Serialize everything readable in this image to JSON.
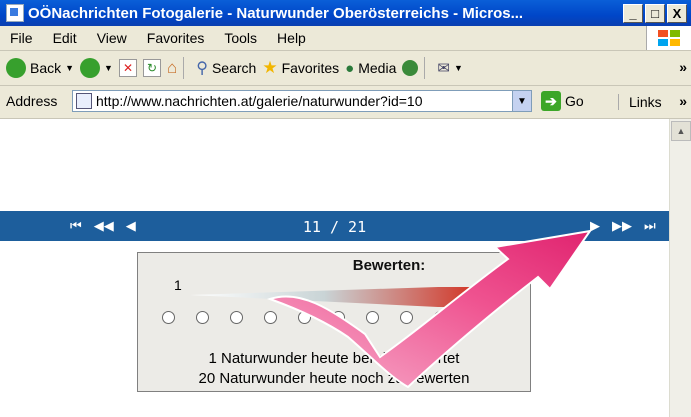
{
  "window": {
    "title": "OÖNachrichten Fotogalerie - Naturwunder Oberösterreichs - Micros...",
    "buttons": [
      "_",
      "□",
      "X"
    ]
  },
  "menu": [
    "File",
    "Edit",
    "View",
    "Favorites",
    "Tools",
    "Help"
  ],
  "toolbar": {
    "back": "Back",
    "search": "Search",
    "favorites": "Favorites",
    "media": "Media",
    "more": "»"
  },
  "address": {
    "label": "Address",
    "url": "http://www.nachrichten.at/galerie/naturwunder?id=10",
    "go": "Go",
    "links": "Links",
    "more": "»"
  },
  "gallery": {
    "counter": "11 / 21",
    "nav_left": [
      "⏮",
      "◀◀",
      "◀"
    ],
    "nav_right": [
      "▶",
      "▶▶",
      "⏭"
    ]
  },
  "rating": {
    "title": "Bewerten:",
    "value": "1",
    "options": 9,
    "info_rated": "1 Naturwunder heute bereits bewertet",
    "info_pending": "20 Naturwunder heute noch zu bewerten"
  },
  "colors": {
    "titlebar": "#0046c8",
    "navbar": "#1d5e9c",
    "arrow": "#ee4f8c"
  }
}
